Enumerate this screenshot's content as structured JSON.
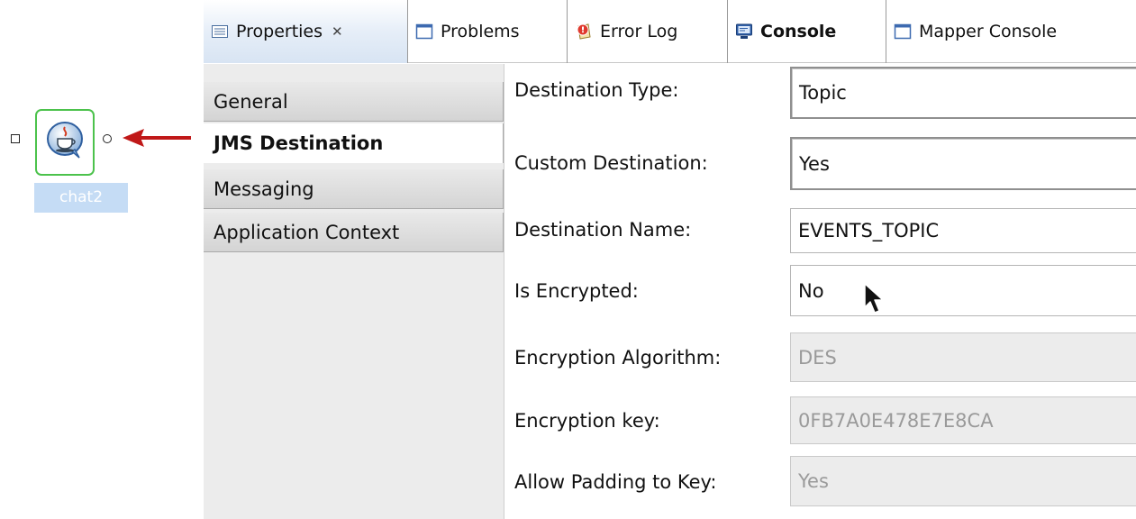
{
  "canvas": {
    "node": {
      "label": "chat2",
      "icon": "java-bean-icon"
    }
  },
  "tabs": [
    {
      "label": "Properties",
      "icon": "properties-icon",
      "closable": true,
      "active": true
    },
    {
      "label": "Problems",
      "icon": "view-window-icon"
    },
    {
      "label": "Error Log",
      "icon": "error-log-icon"
    },
    {
      "label": "Console",
      "icon": "console-icon",
      "bold": true
    },
    {
      "label": "Mapper Console",
      "icon": "view-window-icon"
    }
  ],
  "sections": [
    {
      "label": "General"
    },
    {
      "label": "JMS Destination",
      "selected": true
    },
    {
      "label": "Messaging"
    },
    {
      "label": "Application Context"
    }
  ],
  "properties": [
    {
      "label": "Destination Type:",
      "value": "Topic",
      "enabled": true
    },
    {
      "label": "Custom Destination:",
      "value": "Yes",
      "enabled": true
    },
    {
      "label": "Destination Name:",
      "value": "EVENTS_TOPIC",
      "enabled": true
    },
    {
      "label": "Is Encrypted:",
      "value": "No",
      "enabled": true
    },
    {
      "label": "Encryption Algorithm:",
      "value": "DES",
      "enabled": false
    },
    {
      "label": "Encryption key:",
      "value": "0FB7A0E478E7E8CA",
      "enabled": false
    },
    {
      "label": "Allow Padding to Key:",
      "value": "Yes",
      "enabled": false
    }
  ],
  "colors": {
    "node_border": "#4cc24c",
    "node_label_bg": "#c5dcf5",
    "arrow": "#c01818",
    "active_tab": "#d8e4f3"
  }
}
